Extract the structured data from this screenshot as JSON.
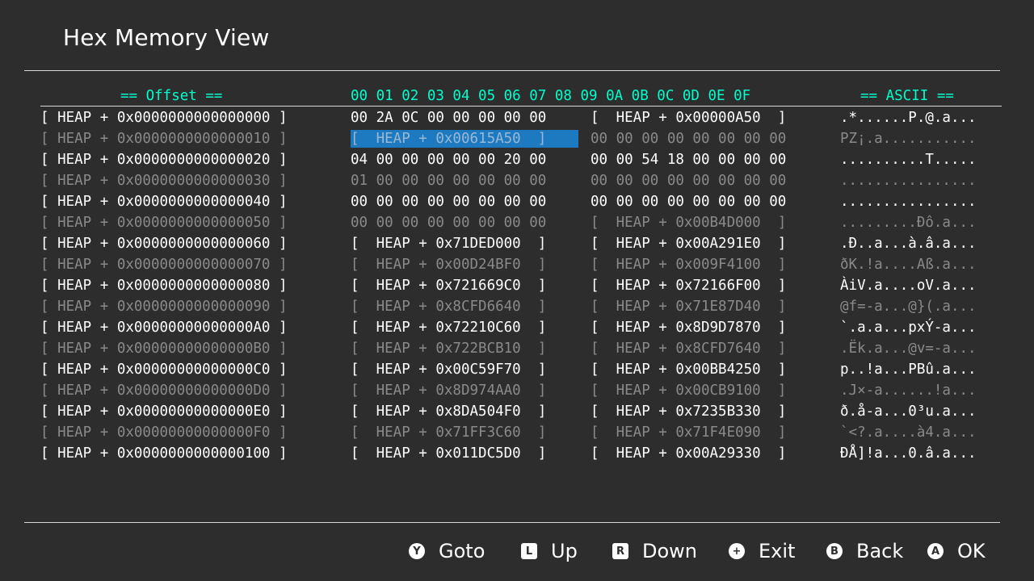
{
  "title": "Hex Memory View",
  "headers": {
    "offset": "== Offset ==",
    "bytes": "00 01 02 03 04 05 06 07 08 09 0A 0B 0C 0D 0E 0F",
    "ascii": "== ASCII =="
  },
  "rows": [
    {
      "offset": "[ HEAP + 0x0000000000000000 ]",
      "data": "00 2A 0C 00 00 00 00 00",
      "data2": "[  HEAP + 0x00000A50  ]",
      "ascii": ".*......P.@.a...",
      "dim": false
    },
    {
      "offset": "[ HEAP + 0x0000000000000010 ]",
      "data": "[  HEAP + 0x00615A50  ]",
      "data2": "00 00 00 00 00 00 00 00",
      "ascii": "PZ¡.a...........",
      "dim": true,
      "selected": true
    },
    {
      "offset": "[ HEAP + 0x0000000000000020 ]",
      "data": "04 00 00 00 00 00 20 00",
      "data2": "00 00 54 18 00 00 00 00",
      "ascii": "..........T.....",
      "dim": false
    },
    {
      "offset": "[ HEAP + 0x0000000000000030 ]",
      "data": "01 00 00 00 00 00 00 00",
      "data2": "00 00 00 00 00 00 00 00",
      "ascii": "................",
      "dim": true
    },
    {
      "offset": "[ HEAP + 0x0000000000000040 ]",
      "data": "00 00 00 00 00 00 00 00",
      "data2": "00 00 00 00 00 00 00 00",
      "ascii": "................",
      "dim": false
    },
    {
      "offset": "[ HEAP + 0x0000000000000050 ]",
      "data": "00 00 00 00 00 00 00 00",
      "data2": "[  HEAP + 0x00B4D000  ]",
      "ascii": ".........Ðô.a...",
      "dim": true
    },
    {
      "offset": "[ HEAP + 0x0000000000000060 ]",
      "data": "[  HEAP + 0x71DED000  ]",
      "data2": "[  HEAP + 0x00A291E0  ]",
      "ascii": ".Ð..a...à.â.a...",
      "dim": false
    },
    {
      "offset": "[ HEAP + 0x0000000000000070 ]",
      "data": "[  HEAP + 0x00D24BF0  ]",
      "data2": "[  HEAP + 0x009F4100  ]",
      "ascii": "ðK.!a....Aß.a...",
      "dim": true
    },
    {
      "offset": "[ HEAP + 0x0000000000000080 ]",
      "data": "[  HEAP + 0x721669C0  ]",
      "data2": "[  HEAP + 0x72166F00  ]",
      "ascii": "ÀiV.a....oV.a...",
      "dim": false
    },
    {
      "offset": "[ HEAP + 0x0000000000000090 ]",
      "data": "[  HEAP + 0x8CFD6640  ]",
      "data2": "[  HEAP + 0x71E87D40  ]",
      "ascii": "@f=-a...@}(.a...",
      "dim": true
    },
    {
      "offset": "[ HEAP + 0x00000000000000A0 ]",
      "data": "[  HEAP + 0x72210C60  ]",
      "data2": "[  HEAP + 0x8D9D7870  ]",
      "ascii": "`.a.a...pxÝ-a...",
      "dim": false
    },
    {
      "offset": "[ HEAP + 0x00000000000000B0 ]",
      "data": "[  HEAP + 0x722BCB10  ]",
      "data2": "[  HEAP + 0x8CFD7640  ]",
      "ascii": ".Ëk.a...@v=-a...",
      "dim": true
    },
    {
      "offset": "[ HEAP + 0x00000000000000C0 ]",
      "data": "[  HEAP + 0x00C59F70  ]",
      "data2": "[  HEAP + 0x00BB4250  ]",
      "ascii": "p..!a...PBû.a...",
      "dim": false
    },
    {
      "offset": "[ HEAP + 0x00000000000000D0 ]",
      "data": "[  HEAP + 0x8D974AA0  ]",
      "data2": "[  HEAP + 0x00CB9100  ]",
      "ascii": ".J×-a......!a...",
      "dim": true
    },
    {
      "offset": "[ HEAP + 0x00000000000000E0 ]",
      "data": "[  HEAP + 0x8DA504F0  ]",
      "data2": "[  HEAP + 0x7235B330  ]",
      "ascii": "ð.å-a...0³u.a...",
      "dim": false
    },
    {
      "offset": "[ HEAP + 0x00000000000000F0 ]",
      "data": "[  HEAP + 0x71FF3C60  ]",
      "data2": "[  HEAP + 0x71F4E090  ]",
      "ascii": "`<?.a....à4.a...",
      "dim": true
    },
    {
      "offset": "[ HEAP + 0x0000000000000100 ]",
      "data": "[  HEAP + 0x011DC5D0  ]",
      "data2": "[  HEAP + 0x00A29330  ]",
      "ascii": "ÐÅ]!a...0.â.a...",
      "dim": false
    }
  ],
  "footer": [
    {
      "key": "Y",
      "label": "Goto",
      "shape": "circle",
      "icon": "y-button-icon"
    },
    {
      "key": "L",
      "label": "Up",
      "shape": "square",
      "icon": "l-button-icon"
    },
    {
      "key": "R",
      "label": "Down",
      "shape": "square",
      "icon": "r-button-icon"
    },
    {
      "key": "+",
      "label": "Exit",
      "shape": "circle",
      "icon": "plus-button-icon"
    },
    {
      "key": "B",
      "label": "Back",
      "shape": "circle",
      "icon": "b-button-icon"
    },
    {
      "key": "A",
      "label": "OK",
      "shape": "circle",
      "icon": "a-button-icon"
    }
  ],
  "colors": {
    "background": "#2d2d2d",
    "header_accent": "#00ffcc",
    "selection": "#1d79c0",
    "dim_text": "#8a8a8a"
  }
}
